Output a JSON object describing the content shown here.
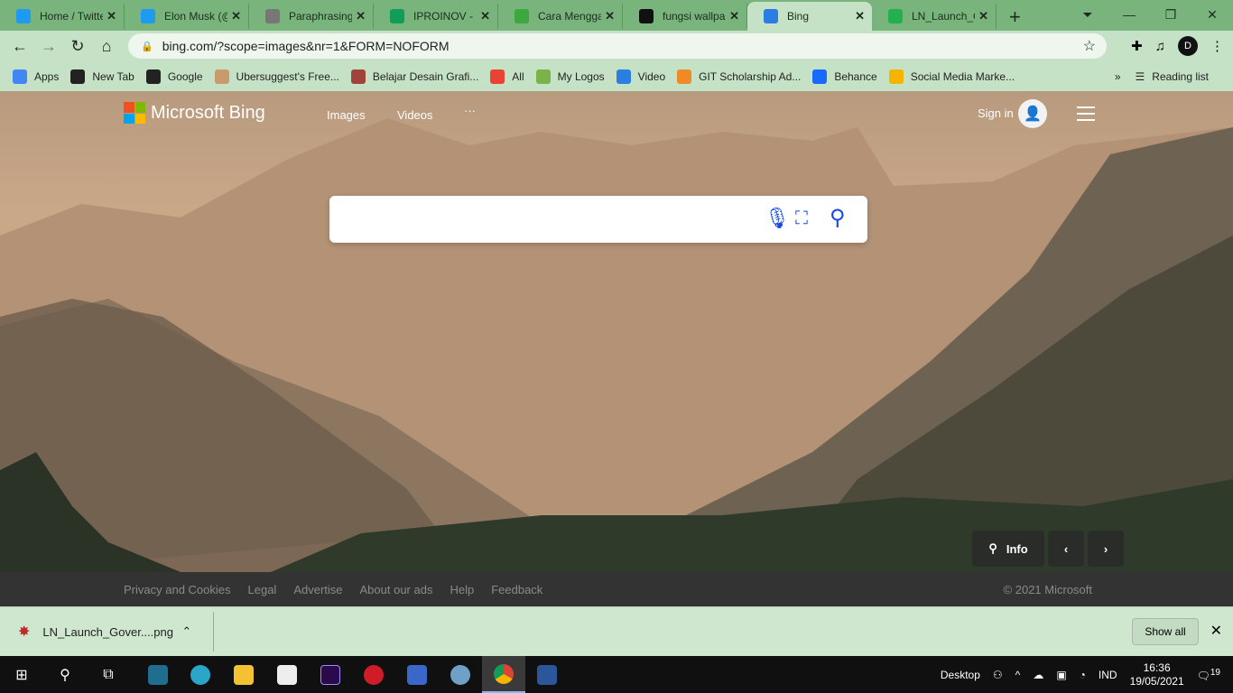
{
  "tabs": [
    {
      "title": "Home / Twitter",
      "icon": "twitter-icon",
      "color": "#1d9bf0"
    },
    {
      "title": "Elon Musk (@elonmusk)",
      "icon": "twitter-icon",
      "color": "#1d9bf0"
    },
    {
      "title": "Paraphrasing Tool",
      "icon": "feather-icon",
      "color": "#777"
    },
    {
      "title": "IPROINOV - Google Sheets",
      "icon": "sheets-icon",
      "color": "#0f9d58"
    },
    {
      "title": "Cara Menggambar",
      "icon": "page-icon",
      "color": "#3da83d"
    },
    {
      "title": "fungsi wallpaper",
      "icon": "b-icon",
      "color": "#111"
    },
    {
      "title": "Bing",
      "icon": "bing-icon",
      "color": "#2a7de1"
    },
    {
      "title": "LN_Launch_Government",
      "icon": "bolt-icon",
      "color": "#22b14c"
    }
  ],
  "active_tab": 6,
  "address": "bing.com/?scope=images&nr=1&FORM=NOFORM",
  "bookmarks": [
    {
      "label": "Apps",
      "icon": "apps-icon",
      "color": "#4285f4"
    },
    {
      "label": "New Tab",
      "icon": "globe-icon",
      "color": "#222"
    },
    {
      "label": "Google",
      "icon": "globe-icon",
      "color": "#222"
    },
    {
      "label": "Ubersuggest's Free...",
      "icon": "face-icon",
      "color": "#c99a6b"
    },
    {
      "label": "Belajar Desain Grafi...",
      "icon": "book-icon",
      "color": "#a0443a"
    },
    {
      "label": "All",
      "icon": "google-icon",
      "color": "#ea4335"
    },
    {
      "label": "My Logos",
      "icon": "leaf-icon",
      "color": "#7ab34a"
    },
    {
      "label": "Video",
      "icon": "video-icon",
      "color": "#2a7de1"
    },
    {
      "label": "GIT Scholarship Ad...",
      "icon": "git-icon",
      "color": "#f08a24"
    },
    {
      "label": "Behance",
      "icon": "behance-icon",
      "color": "#1769ff"
    },
    {
      "label": "Social Media Marke...",
      "icon": "drive-icon",
      "color": "#f4b400"
    }
  ],
  "reading_list": "Reading list",
  "bing": {
    "brand": "Microsoft Bing",
    "nav": [
      "Images",
      "Videos",
      "···"
    ],
    "sign_in": "Sign in",
    "search_placeholder": "",
    "info": "Info",
    "footer": [
      "Privacy and Cookies",
      "Legal",
      "Advertise",
      "About our ads",
      "Help",
      "Feedback"
    ],
    "copyright": "© 2021 Microsoft"
  },
  "download": {
    "file": "LN_Launch_Gover....png",
    "show_all": "Show all"
  },
  "taskbar": {
    "desktop": "Desktop",
    "lang": "IND",
    "time": "16:36",
    "date": "19/05/2021",
    "notifications": "19"
  }
}
